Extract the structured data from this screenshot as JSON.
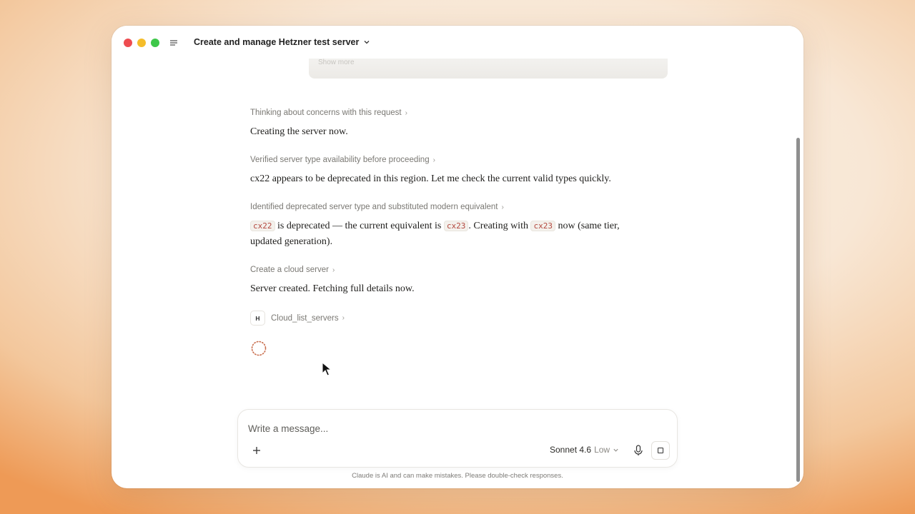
{
  "window": {
    "title": "Create and manage Hetzner test server"
  },
  "previous_card": {
    "show_more_label": "Show more"
  },
  "conversation": {
    "step1": {
      "label": "Thinking about concerns with this request"
    },
    "msg1": {
      "text": "Creating the server now."
    },
    "step2": {
      "label": "Verified server type availability before proceeding"
    },
    "msg2": {
      "text": "cx22 appears to be deprecated in this region. Let me check the current valid types quickly."
    },
    "step3": {
      "label": "Identified deprecated server type and substituted modern equivalent"
    },
    "msg3": {
      "code1": "cx22",
      "part1": " is deprecated — the current equivalent is ",
      "code2": "cx23",
      "part2": ". Creating with ",
      "code3": "cx23",
      "part3": " now (same tier, updated generation)."
    },
    "step4": {
      "label": "Create a cloud server"
    },
    "msg4": {
      "text": "Server created. Fetching full details now."
    },
    "tool": {
      "badge": "H",
      "label": "Cloud_list_servers"
    }
  },
  "composer": {
    "placeholder": "Write a message...",
    "model": "Sonnet 4.6",
    "effort": "Low"
  },
  "footer": {
    "disclaimer": "Claude is AI and can make mistakes. Please double-check responses."
  },
  "colors": {
    "accent": "#b3483f",
    "spinner": "#c96f4f"
  }
}
